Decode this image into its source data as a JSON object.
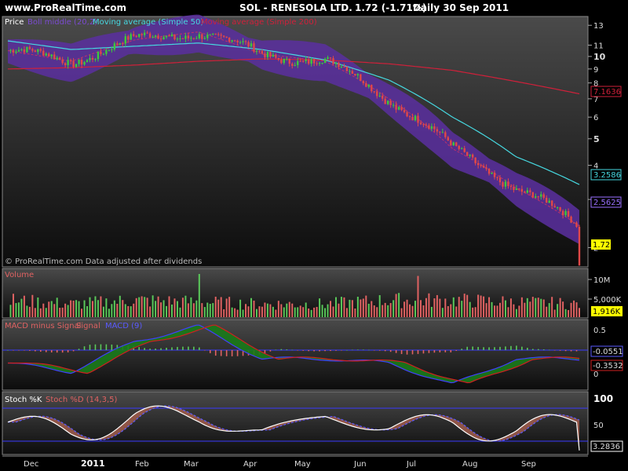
{
  "header": {
    "site": "www.ProRealTime.com",
    "symbol": "SOL - RENESOLA LTD.",
    "price": "1.72 (-1.71%)",
    "period": "Daily  30 Sep 2011"
  },
  "colors": {
    "background": "#000000",
    "bollinger_band": "#5a2fa0",
    "bollinger_mid": "#c0306a",
    "ma50": "#46d8e0",
    "ma200": "#d0203a",
    "candle_up": "#3cc83c",
    "candle_down": "#e04848",
    "volume_up": "#5ac85a",
    "volume_down": "#e06262",
    "macd_line": "#4040ff",
    "signal_line": "#d02020",
    "stoch_k": "#ffffff",
    "stoch_d": "#5a5aff",
    "stoch_fill": "#9a5a4a",
    "last_price_tag": "#ffff00",
    "ma50_tag": "#46d8e0",
    "ma200_tag": "#d0203a",
    "boll_tag": "#9a70ff"
  },
  "price_panel": {
    "legend": {
      "price": "Price",
      "boll": "Boll middle (20,2)",
      "ma50": "Moving average (Simple 50)",
      "ma200": "Moving average (Simple 200)"
    },
    "footnote": "© ProRealTime.com  Data adjusted after dividends",
    "y_ticks": [
      "13",
      "11",
      "10",
      "9",
      "8",
      "7",
      "6",
      "5",
      "4",
      "3",
      "2"
    ],
    "tags": {
      "ma200": "7.1636",
      "ma50": "3.2586",
      "boll": "2.5625",
      "last": "1.72"
    }
  },
  "volume_panel": {
    "label": "Volume",
    "y_ticks": [
      "10M",
      "5,000K"
    ],
    "tag": "1,916K"
  },
  "macd_panel": {
    "label_hist": "MACD minus Signal",
    "label_signal": "Signal",
    "label_macd": "MACD (9)",
    "y_ticks": [
      "0.5",
      "0"
    ],
    "tags": {
      "macd": "-0.0551",
      "signal": "-0.3532"
    }
  },
  "stoch_panel": {
    "label_k": "Stoch %K",
    "label_d": "Stoch %D (14,3,5)",
    "y_ticks": [
      "100",
      "50"
    ],
    "tag": "3.2836"
  },
  "x_axis": {
    "labels": [
      "Dec",
      "2011",
      "Feb",
      "Mar",
      "Apr",
      "May",
      "Jun",
      "Jul",
      "Aug",
      "Sep"
    ]
  },
  "chart_data": {
    "type": "line",
    "title": "SOL - RENESOLA LTD.",
    "x": [
      "Dec",
      "2011",
      "Feb",
      "Mar",
      "Apr",
      "May",
      "Jun",
      "Jul",
      "Aug",
      "Sep"
    ],
    "series": [
      {
        "name": "Price",
        "values": [
          10.5,
          9.6,
          11.5,
          12.3,
          10.2,
          9.6,
          7.0,
          4.6,
          3.3,
          2.4
        ]
      },
      {
        "name": "Moving average (Simple 50)",
        "values": [
          11.4,
          10.6,
          10.9,
          11.2,
          10.6,
          9.7,
          8.2,
          6.0,
          4.3,
          3.4
        ]
      },
      {
        "name": "Moving average (Simple 200)",
        "values": [
          9.0,
          9.1,
          9.3,
          9.6,
          9.8,
          9.7,
          9.4,
          8.9,
          8.1,
          7.3
        ]
      },
      {
        "name": "Volume",
        "values": [
          4.5,
          3.5,
          4.5,
          4.0,
          3.5,
          3.5,
          4.5,
          4.5,
          4.0,
          3.5
        ]
      },
      {
        "name": "MACD (9)",
        "values": [
          -0.3,
          -0.5,
          0.2,
          0.55,
          -0.2,
          -0.2,
          -0.3,
          -0.8,
          -0.2,
          -0.2
        ]
      },
      {
        "name": "Stoch %K",
        "values": [
          50,
          30,
          85,
          80,
          25,
          95,
          30,
          70,
          20,
          60
        ]
      }
    ],
    "ylabel": "",
    "y_scale": "log",
    "ylim": [
      1.7,
      14
    ]
  }
}
